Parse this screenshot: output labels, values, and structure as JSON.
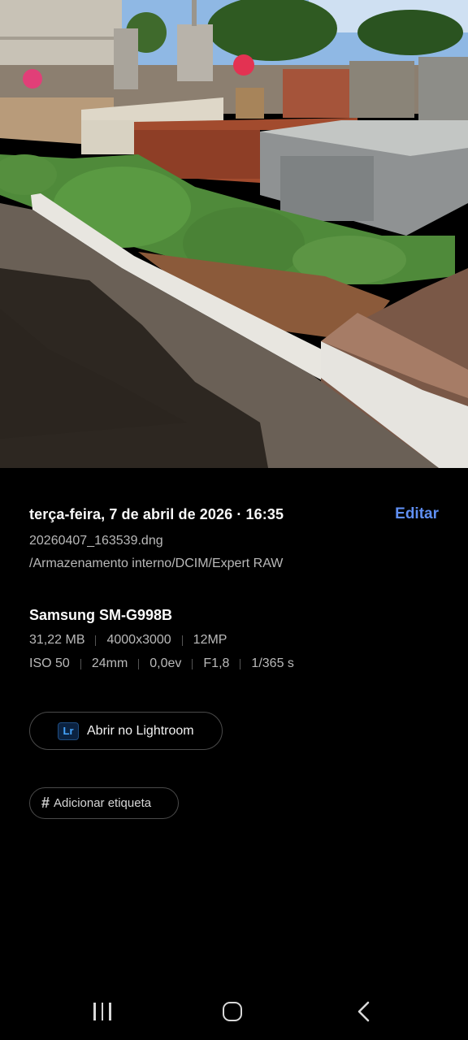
{
  "photo": {
    "icon": "photo-preview"
  },
  "details": {
    "datetime": "terça-feira, 7 de abril de 2026 · 16:35",
    "edit_label": "Editar",
    "filename": "20260407_163539.dng",
    "path": "/Armazenamento interno/DCIM/Expert RAW",
    "device": "Samsung SM-G998B",
    "file_size": "31,22 MB",
    "resolution": "4000x3000",
    "megapixels": "12MP",
    "iso": "ISO 50",
    "focal_length": "24mm",
    "exposure_value": "0,0ev",
    "aperture": "F1,8",
    "shutter_speed": "1/365 s",
    "lightroom_icon_text": "Lr",
    "lightroom_label": "Abrir no Lightroom",
    "tag_icon": "#",
    "tag_label": "Adicionar etiqueta",
    "accent_color": "#5f8ff3"
  },
  "navbar": {
    "recents_icon": "recents-icon",
    "home_icon": "home-icon",
    "back_icon": "back-icon"
  }
}
